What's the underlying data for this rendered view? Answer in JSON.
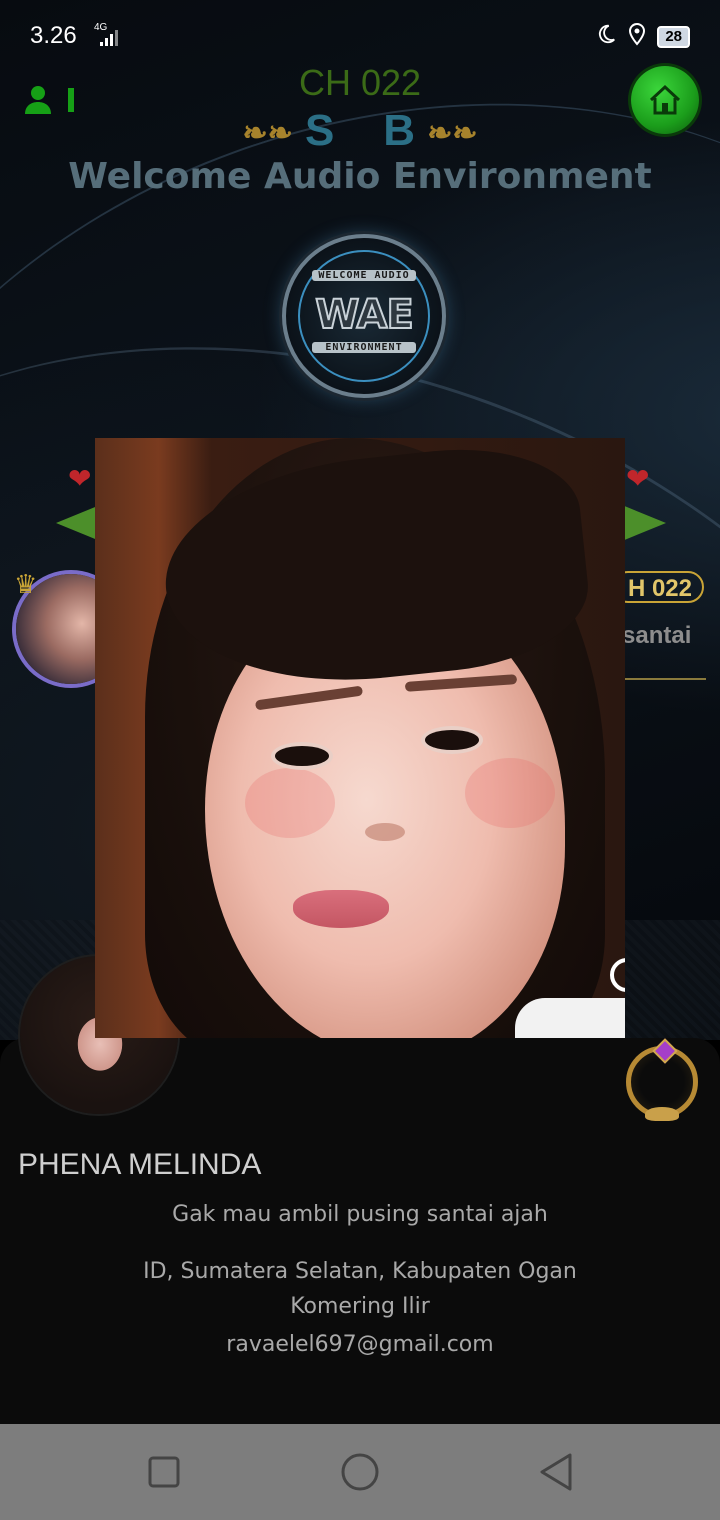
{
  "status_bar": {
    "time": "3.26",
    "network": "4G",
    "battery": "28"
  },
  "header": {
    "channel": "CH 022",
    "sb_letters": [
      "S",
      "B"
    ],
    "welcome": "Welcome Audio Environment"
  },
  "logo": {
    "top_text": "WELCOME AUDIO",
    "main_text": "WAE",
    "bottom_text": "ENVIRONMENT"
  },
  "background_card": {
    "channel_badge": "H 022",
    "status_fragment": "santai"
  },
  "profile": {
    "name": "PHENA MELINDA",
    "bio": "Gak mau ambil pusing santai ajah",
    "location": "ID, Sumatera Selatan, Kabupaten Ogan Komering Ilir",
    "email": "ravaelel697@gmail.com"
  },
  "colors": {
    "channel_green": "#3b6b17",
    "welcome_gray": "#566e7a",
    "home_green": "#22b022",
    "gold": "#c9a436"
  }
}
